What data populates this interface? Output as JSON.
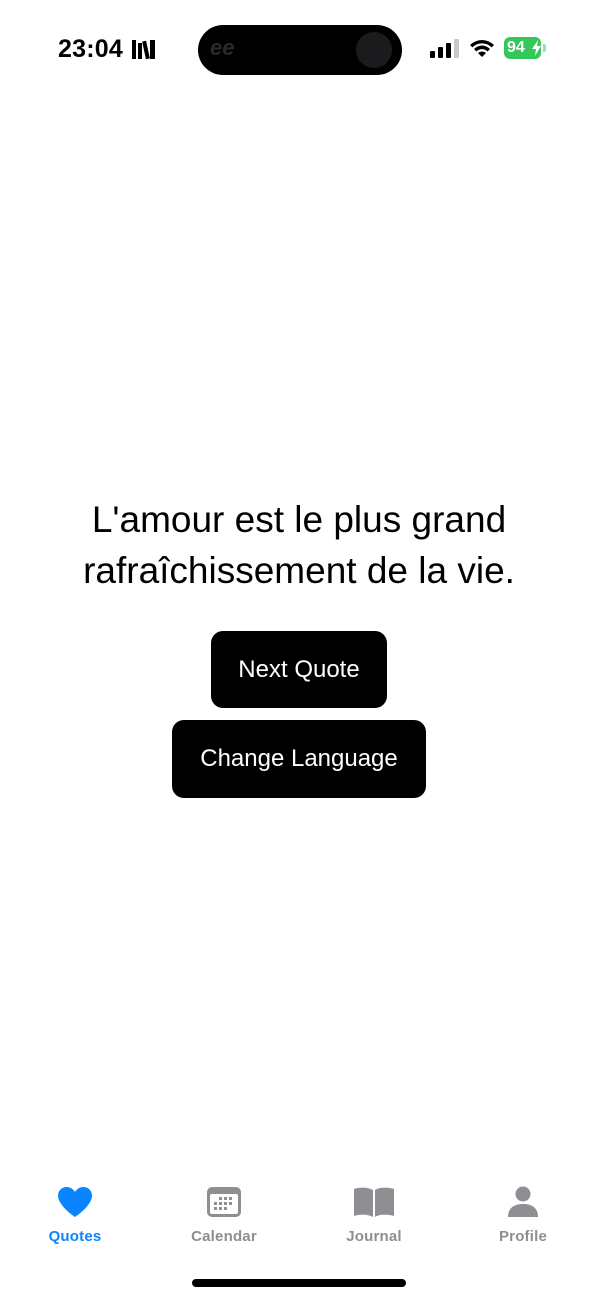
{
  "status_bar": {
    "time": "23:04",
    "battery_percent": "94",
    "battery_level": 0.94,
    "battery_color": "#34c759",
    "icons": [
      "books-icon",
      "cellular-signal-icon",
      "wifi-icon",
      "battery-icon",
      "charging-bolt-icon"
    ]
  },
  "main": {
    "quote": "L'amour est le plus grand rafraîchissement de la vie.",
    "next_button_label": "Next Quote",
    "language_button_label": "Change Language"
  },
  "tab_bar": {
    "active_color": "#0a84ff",
    "inactive_color": "#8e8e93",
    "items": [
      {
        "label": "Quotes",
        "icon": "heart-icon",
        "active": true
      },
      {
        "label": "Calendar",
        "icon": "calendar-icon",
        "active": false
      },
      {
        "label": "Journal",
        "icon": "book-icon",
        "active": false
      },
      {
        "label": "Profile",
        "icon": "person-icon",
        "active": false
      }
    ]
  }
}
